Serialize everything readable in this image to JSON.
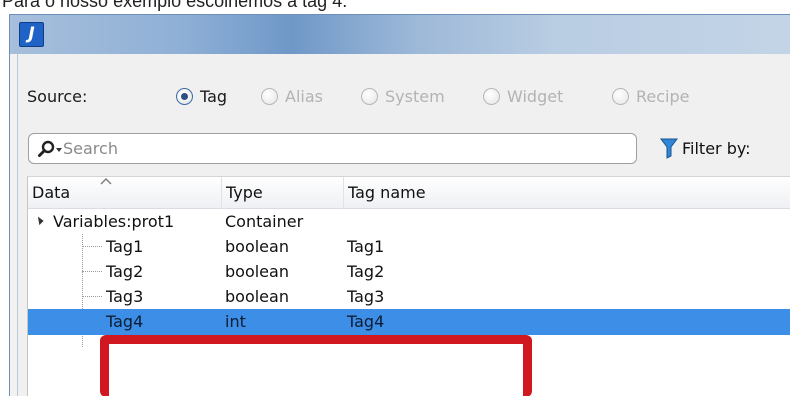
{
  "caption": "Para o nosso exemplo escolhemos a tag 4.",
  "window": {
    "app_icon_letter": "J"
  },
  "source": {
    "label": "Source:",
    "options": [
      {
        "label": "Tag",
        "checked": true
      },
      {
        "label": "Alias",
        "checked": false
      },
      {
        "label": "System",
        "checked": false
      },
      {
        "label": "Widget",
        "checked": false
      },
      {
        "label": "Recipe",
        "checked": false
      }
    ]
  },
  "search": {
    "placeholder": "Search"
  },
  "filter": {
    "label": "Filter by:"
  },
  "grid": {
    "columns": [
      "Data",
      "Type",
      "Tag name"
    ],
    "rows": [
      {
        "data": "Variables:prot1",
        "type": "Container",
        "tag_name": ""
      },
      {
        "data": "Tag1",
        "type": "boolean",
        "tag_name": "Tag1"
      },
      {
        "data": "Tag2",
        "type": "boolean",
        "tag_name": "Tag2"
      },
      {
        "data": "Tag3",
        "type": "boolean",
        "tag_name": "Tag3"
      },
      {
        "data": "Tag4",
        "type": "int",
        "tag_name": "Tag4"
      }
    ]
  },
  "colors": {
    "selection": "#3d8ee6",
    "highlight_box": "#d11820",
    "accent": "#1f63c6"
  }
}
